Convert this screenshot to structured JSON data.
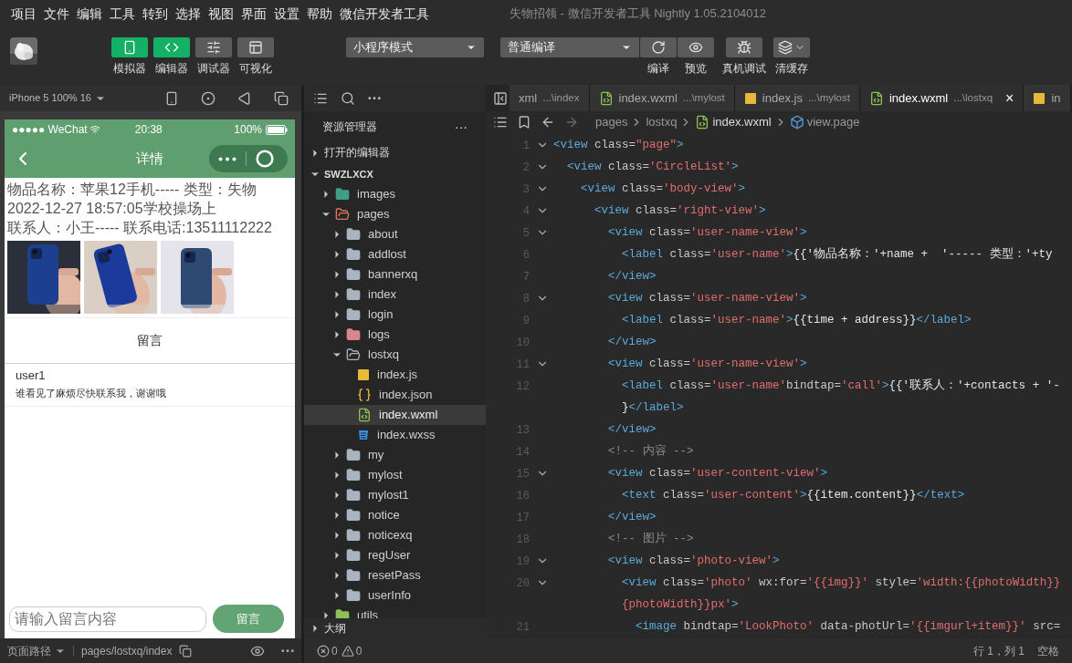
{
  "menu": [
    "项目",
    "文件",
    "编辑",
    "工具",
    "转到",
    "选择",
    "视图",
    "界面",
    "设置",
    "帮助",
    "微信开发者工具"
  ],
  "window_title": "失物招领 - 微信开发者工具 Nightly 1.05.2104012",
  "toolbar": {
    "view_buttons": [
      {
        "label": "模拟器",
        "kind": "phone",
        "selected": true
      },
      {
        "label": "编辑器",
        "kind": "code",
        "selected": true
      },
      {
        "label": "调试器",
        "kind": "sliders",
        "selected": false
      },
      {
        "label": "可视化",
        "kind": "layout",
        "selected": false
      }
    ],
    "mode_select": "小程序模式",
    "compile_select": "普通编译",
    "actions": [
      {
        "label": "编译",
        "kind": "refresh"
      },
      {
        "label": "预览",
        "kind": "eye"
      },
      {
        "label": "真机调试",
        "kind": "bug"
      },
      {
        "label": "清缓存",
        "kind": "layers"
      }
    ]
  },
  "simulator": {
    "device": "iPhone 5 100% 16",
    "carrier": "●●●●● WeChat",
    "time": "20:38",
    "battery": "100%",
    "nav_title": "详情",
    "lines": [
      "物品名称：苹果12手机----- 类型：失物",
      "2022-12-27 18:57:05学校操场上",
      "联系人：小王----- 联系电话:13511112222"
    ],
    "photos": [
      {
        "kind": "picture"
      },
      {
        "kind": "picture"
      },
      {
        "kind": "picture"
      }
    ],
    "section_title": "留言",
    "comments": [
      {
        "user": "user1",
        "text": "谁看见了麻烦尽快联系我，谢谢哦"
      }
    ],
    "input": {
      "placeholder": "请输入留言内容"
    },
    "submit": "留言"
  },
  "simulator_footer": {
    "path_label": "页面路径",
    "path": "pages/lostxq/index"
  },
  "explorer": {
    "title": "资源管理器",
    "more": "···",
    "open_editors": "打开的编辑器",
    "project": "SWZLXCX",
    "outline": "大纲",
    "tree": [
      {
        "name": "images",
        "kind": "images-folder",
        "expanded": false,
        "selected": false
      },
      {
        "name": "pages",
        "kind": "pages-folder",
        "expanded": true,
        "selected": false,
        "children": [
          {
            "name": "about",
            "kind": "folder",
            "expanded": false,
            "selected": false
          },
          {
            "name": "addlost",
            "kind": "folder",
            "expanded": false,
            "selected": false
          },
          {
            "name": "bannerxq",
            "kind": "folder",
            "expanded": false,
            "selected": false
          },
          {
            "name": "index",
            "kind": "folder",
            "expanded": false,
            "selected": false
          },
          {
            "name": "login",
            "kind": "folder",
            "expanded": false,
            "selected": false
          },
          {
            "name": "logs",
            "kind": "logs-folder",
            "expanded": false,
            "selected": false
          },
          {
            "name": "lostxq",
            "kind": "folder",
            "expanded": true,
            "selected": false,
            "children": [
              {
                "name": "index.js",
                "kind": "js",
                "selected": false
              },
              {
                "name": "index.json",
                "kind": "json",
                "selected": false
              },
              {
                "name": "index.wxml",
                "kind": "wxml",
                "selected": true
              },
              {
                "name": "index.wxss",
                "kind": "wxss",
                "selected": false
              }
            ]
          },
          {
            "name": "my",
            "kind": "folder",
            "expanded": false,
            "selected": false
          },
          {
            "name": "mylost",
            "kind": "folder",
            "expanded": false,
            "selected": false
          },
          {
            "name": "mylost1",
            "kind": "folder",
            "expanded": false,
            "selected": false
          },
          {
            "name": "notice",
            "kind": "folder",
            "expanded": false,
            "selected": false
          },
          {
            "name": "noticexq",
            "kind": "folder",
            "expanded": false,
            "selected": false
          },
          {
            "name": "regUser",
            "kind": "folder",
            "expanded": false,
            "selected": false
          },
          {
            "name": "resetPass",
            "kind": "folder",
            "expanded": false,
            "selected": false
          },
          {
            "name": "userInfo",
            "kind": "folder",
            "expanded": false,
            "selected": false
          }
        ]
      },
      {
        "name": "utils",
        "kind": "utils-folder",
        "expanded": false,
        "selected": false
      }
    ]
  },
  "tabs": [
    {
      "name": "xml",
      "path": "...\\index",
      "kind": "plain",
      "selected": false
    },
    {
      "name": "index.wxml",
      "path": "...\\mylost",
      "kind": "wxml",
      "selected": false
    },
    {
      "name": "index.js",
      "path": "...\\mylost",
      "kind": "js",
      "selected": false
    },
    {
      "name": "index.wxml",
      "path": "...\\lostxq",
      "kind": "wxml",
      "selected": true,
      "close": "×"
    },
    {
      "name": "in",
      "kind": "js",
      "selected": false
    }
  ],
  "breadcrumb": [
    {
      "label": "pages",
      "kind": "folder"
    },
    {
      "label": "lostxq",
      "kind": "folder"
    },
    {
      "label": "index.wxml",
      "kind": "wxml"
    },
    {
      "label": "view.page",
      "kind": "element"
    }
  ],
  "code": [
    {
      "number": "1",
      "fold": true,
      "tokens": [
        {
          "kind": "tag",
          "text": "<view"
        },
        {
          "kind": "attr",
          "text": " class="
        },
        {
          "kind": "string",
          "text": "\"page\""
        },
        {
          "kind": "tag",
          "text": ">"
        }
      ]
    },
    {
      "number": "2",
      "fold": true,
      "tokens": [
        {
          "kind": "tag",
          "text": "  <view"
        },
        {
          "kind": "attr",
          "text": " class="
        },
        {
          "kind": "string",
          "text": "'CircleList'"
        },
        {
          "kind": "tag",
          "text": ">"
        }
      ]
    },
    {
      "number": "3",
      "fold": true,
      "tokens": [
        {
          "kind": "tag",
          "text": "    <view"
        },
        {
          "kind": "attr",
          "text": " class="
        },
        {
          "kind": "string",
          "text": "'body-view'"
        },
        {
          "kind": "tag",
          "text": ">"
        }
      ]
    },
    {
      "number": "4",
      "fold": true,
      "tokens": [
        {
          "kind": "tag",
          "text": "      <view"
        },
        {
          "kind": "attr",
          "text": " class="
        },
        {
          "kind": "string",
          "text": "'right-view'"
        },
        {
          "kind": "tag",
          "text": ">"
        }
      ]
    },
    {
      "number": "5",
      "fold": true,
      "tokens": [
        {
          "kind": "tag",
          "text": "        <view"
        },
        {
          "kind": "attr",
          "text": " class="
        },
        {
          "kind": "string",
          "text": "'user-name-view'"
        },
        {
          "kind": "tag",
          "text": ">"
        }
      ]
    },
    {
      "number": "6",
      "fold": false,
      "tokens": [
        {
          "kind": "tag",
          "text": "          <label"
        },
        {
          "kind": "attr",
          "text": " class="
        },
        {
          "kind": "string",
          "text": "'user-name'"
        },
        {
          "kind": "tag",
          "text": ">"
        },
        {
          "kind": "text",
          "text": "{{'物品名称：'+name +  '----- 类型：'+ty"
        }
      ]
    },
    {
      "number": "7",
      "fold": false,
      "tokens": [
        {
          "kind": "tag",
          "text": "        </view>"
        }
      ]
    },
    {
      "number": "8",
      "fold": true,
      "tokens": [
        {
          "kind": "tag",
          "text": "        <view"
        },
        {
          "kind": "attr",
          "text": " class="
        },
        {
          "kind": "string",
          "text": "'user-name-view'"
        },
        {
          "kind": "tag",
          "text": ">"
        }
      ]
    },
    {
      "number": "9",
      "fold": false,
      "tokens": [
        {
          "kind": "tag",
          "text": "          <label"
        },
        {
          "kind": "attr",
          "text": " class="
        },
        {
          "kind": "string",
          "text": "'user-name'"
        },
        {
          "kind": "tag",
          "text": ">"
        },
        {
          "kind": "text",
          "text": "{{time + address}}"
        },
        {
          "kind": "tag",
          "text": "</label>"
        }
      ]
    },
    {
      "number": "10",
      "fold": false,
      "tokens": [
        {
          "kind": "tag",
          "text": "        </view>"
        }
      ]
    },
    {
      "number": "11",
      "fold": true,
      "tokens": [
        {
          "kind": "tag",
          "text": "        <view"
        },
        {
          "kind": "attr",
          "text": " class="
        },
        {
          "kind": "string",
          "text": "'user-name-view'"
        },
        {
          "kind": "tag",
          "text": ">"
        }
      ]
    },
    {
      "number": "12",
      "fold": false,
      "tokens": [
        {
          "kind": "tag",
          "text": "          <label"
        },
        {
          "kind": "attr",
          "text": " class="
        },
        {
          "kind": "string",
          "text": "'user-name'"
        },
        {
          "kind": "attr",
          "text": "bindtap="
        },
        {
          "kind": "string",
          "text": "'call'"
        },
        {
          "kind": "tag",
          "text": ">"
        },
        {
          "kind": "text",
          "text": "{{'联系人：'+contacts + '-"
        }
      ]
    },
    {
      "fold": false,
      "tokens": [
        {
          "kind": "text",
          "text": "          }"
        },
        {
          "kind": "tag",
          "text": "</label>"
        }
      ]
    },
    {
      "number": "13",
      "fold": false,
      "tokens": [
        {
          "kind": "tag",
          "text": "        </view>"
        }
      ]
    },
    {
      "number": "14",
      "fold": false,
      "tokens": [
        {
          "kind": "comment",
          "text": "        <!-- 内容 -->"
        }
      ]
    },
    {
      "number": "15",
      "fold": true,
      "tokens": [
        {
          "kind": "tag",
          "text": "        <view"
        },
        {
          "kind": "attr",
          "text": " class="
        },
        {
          "kind": "string",
          "text": "'user-content-view'"
        },
        {
          "kind": "tag",
          "text": ">"
        }
      ]
    },
    {
      "number": "16",
      "fold": false,
      "tokens": [
        {
          "kind": "tag",
          "text": "          <text"
        },
        {
          "kind": "attr",
          "text": " class="
        },
        {
          "kind": "string",
          "text": "'user-content'"
        },
        {
          "kind": "tag",
          "text": ">"
        },
        {
          "kind": "text",
          "text": "{{item.content}}"
        },
        {
          "kind": "tag",
          "text": "</text>"
        }
      ]
    },
    {
      "number": "17",
      "fold": false,
      "tokens": [
        {
          "kind": "tag",
          "text": "        </view>"
        }
      ]
    },
    {
      "number": "18",
      "fold": false,
      "tokens": [
        {
          "kind": "comment",
          "text": "        <!-- 图片 -->"
        }
      ]
    },
    {
      "number": "19",
      "fold": true,
      "tokens": [
        {
          "kind": "tag",
          "text": "        <view"
        },
        {
          "kind": "attr",
          "text": " class="
        },
        {
          "kind": "string",
          "text": "'photo-view'"
        },
        {
          "kind": "tag",
          "text": ">"
        }
      ]
    },
    {
      "number": "20",
      "fold": true,
      "tokens": [
        {
          "kind": "tag",
          "text": "          <view"
        },
        {
          "kind": "attr",
          "text": " class="
        },
        {
          "kind": "string",
          "text": "'photo'"
        },
        {
          "kind": "attr",
          "text": " wx:for="
        },
        {
          "kind": "string",
          "text": "'{{img}}'"
        },
        {
          "kind": "attr",
          "text": " style="
        },
        {
          "kind": "string",
          "text": "'width:{{photoWidth}}"
        }
      ]
    },
    {
      "fold": false,
      "tokens": [
        {
          "kind": "string",
          "text": "          {photoWidth}}px'"
        },
        {
          "kind": "tag",
          "text": ">"
        }
      ]
    },
    {
      "number": "21",
      "fold": false,
      "tokens": [
        {
          "kind": "tag",
          "text": "            <image"
        },
        {
          "kind": "attr",
          "text": " bindtap="
        },
        {
          "kind": "string",
          "text": "'LookPhoto'"
        },
        {
          "kind": "attr",
          "text": " data-photUrl="
        },
        {
          "kind": "string",
          "text": "'{{imgurl+item}}'"
        },
        {
          "kind": "attr",
          "text": " src="
        }
      ]
    }
  ],
  "status_bar": {
    "errors": "0",
    "warnings": "0",
    "position": "行 1，列 1",
    "indent": "空格"
  }
}
